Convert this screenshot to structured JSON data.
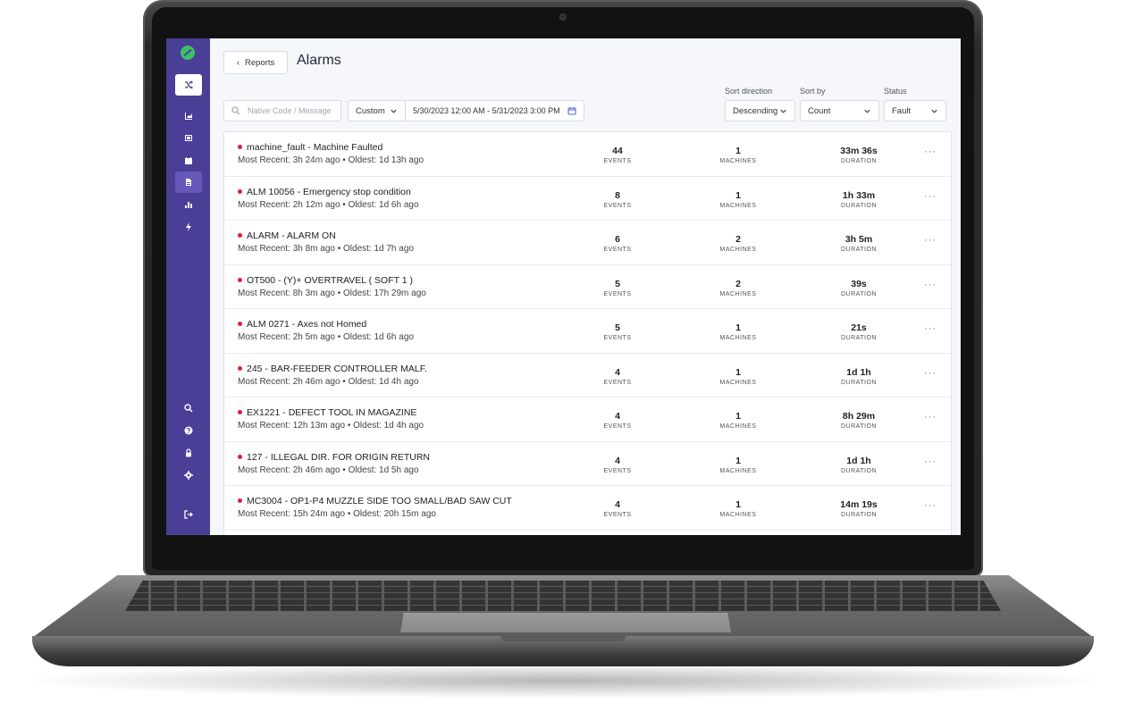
{
  "header": {
    "back_button_label": "Reports",
    "title": "Alarms"
  },
  "sidebar": {
    "items": [
      {
        "icon": "shuffle-icon",
        "active": false
      },
      {
        "icon": "chart-area-icon",
        "active": false
      },
      {
        "icon": "machine-icon",
        "active": false
      },
      {
        "icon": "calendar-icon",
        "active": false
      },
      {
        "icon": "report-icon",
        "active": true
      },
      {
        "icon": "bar-chart-icon",
        "active": false
      },
      {
        "icon": "bolt-icon",
        "active": false
      },
      {
        "icon": "search-icon",
        "active": false
      },
      {
        "icon": "help-icon",
        "active": false
      },
      {
        "icon": "lock-icon",
        "active": false
      },
      {
        "icon": "gear-icon",
        "active": false
      },
      {
        "icon": "logout-icon",
        "active": false
      }
    ]
  },
  "filters": {
    "search_placeholder": "Native Code / Message",
    "range_value": "Custom",
    "date_range_value": "5/30/2023 12:00 AM - 5/31/2023 3:00 PM",
    "sort_direction_label": "Sort direction",
    "sort_direction_value": "Descending",
    "sort_by_label": "Sort by",
    "sort_by_value": "Count",
    "status_label": "Status",
    "status_value": "Fault"
  },
  "column_labels": {
    "events": "EVENTS",
    "machines": "MACHINES",
    "duration": "DURATION"
  },
  "more_label": "···",
  "colors": {
    "sidebar": "#4a3f96",
    "alarm_dot": "#e0202b",
    "accent": "#5c6bd8"
  },
  "alarms": [
    {
      "title": "machine_fault - Machine Faulted",
      "subtitle": "Most Recent: 3h 24m ago • Oldest: 1d 13h ago",
      "events": "44",
      "machines": "1",
      "duration": "33m 36s"
    },
    {
      "title": "ALM 10056 - Emergency stop condition",
      "subtitle": "Most Recent: 2h 12m ago • Oldest: 1d 6h ago",
      "events": "8",
      "machines": "1",
      "duration": "1h 33m"
    },
    {
      "title": "ALARM - ALARM ON",
      "subtitle": "Most Recent: 3h 8m ago • Oldest: 1d 7h ago",
      "events": "6",
      "machines": "2",
      "duration": "3h 5m"
    },
    {
      "title": "OT500 - (Y)+ OVERTRAVEL ( SOFT 1 )",
      "subtitle": "Most Recent: 8h 3m ago • Oldest: 17h 29m ago",
      "events": "5",
      "machines": "2",
      "duration": "39s"
    },
    {
      "title": "ALM 0271 - Axes not Homed",
      "subtitle": "Most Recent: 2h 5m ago • Oldest: 1d 6h ago",
      "events": "5",
      "machines": "1",
      "duration": "21s"
    },
    {
      "title": "245 - BAR-FEEDER CONTROLLER MALF.",
      "subtitle": "Most Recent: 2h 46m ago • Oldest: 1d 4h ago",
      "events": "4",
      "machines": "1",
      "duration": "1d 1h"
    },
    {
      "title": "EX1221 - DEFECT TOOL IN MAGAZINE",
      "subtitle": "Most Recent: 12h 13m ago • Oldest: 1d 4h ago",
      "events": "4",
      "machines": "1",
      "duration": "8h 29m"
    },
    {
      "title": "127 - ILLEGAL DIR. FOR ORIGIN RETURN",
      "subtitle": "Most Recent: 2h 46m ago • Oldest: 1d 5h ago",
      "events": "4",
      "machines": "1",
      "duration": "1d 1h"
    },
    {
      "title": "MC3004 - OP1-P4 MUZZLE SIDE TOO SMALL/BAD SAW CUT",
      "subtitle": "Most Recent: 15h 24m ago • Oldest: 20h 15m ago",
      "events": "4",
      "machines": "1",
      "duration": "14m 19s"
    }
  ]
}
